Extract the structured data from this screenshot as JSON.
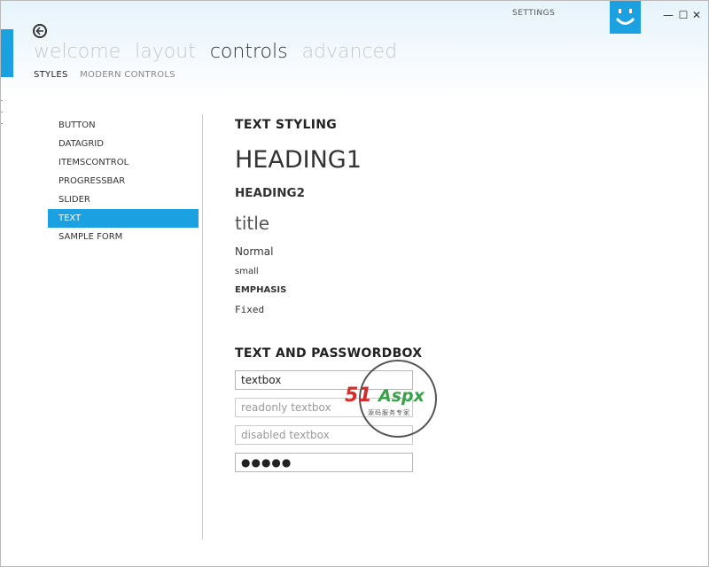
{
  "window": {
    "settings_label": "SETTINGS",
    "minimize": "—",
    "maximize": "☐",
    "close": "✕"
  },
  "nav": {
    "main": [
      "welcome",
      "layout",
      "controls",
      "advanced"
    ],
    "sub": [
      "STYLES",
      "MODERN CONTROLS"
    ]
  },
  "sidebar": {
    "items": [
      {
        "label": "BUTTON"
      },
      {
        "label": "DATAGRID"
      },
      {
        "label": "ITEMSCONTROL"
      },
      {
        "label": "PROGRESSBAR"
      },
      {
        "label": "SLIDER"
      },
      {
        "label": "TEXT"
      },
      {
        "label": "SAMPLE FORM"
      }
    ],
    "selected": "TEXT"
  },
  "content": {
    "section1_title": "TEXT STYLING",
    "heading1": "HEADING1",
    "heading2": "HEADING2",
    "title": "title",
    "normal": "Normal",
    "small": "small",
    "emphasis": "EMPHASIS",
    "fixed": "Fixed",
    "section2_title": "TEXT AND PASSWORDBOX",
    "textbox_value": "textbox",
    "readonly_value": "readonly textbox",
    "disabled_value": "disabled textbox",
    "password_value": "●●●●●"
  },
  "watermark": {
    "brand_red": "51",
    "brand_green": "Aspx",
    "sub": "源码服务专家"
  },
  "colors": {
    "accent": "#1ba1e2"
  }
}
